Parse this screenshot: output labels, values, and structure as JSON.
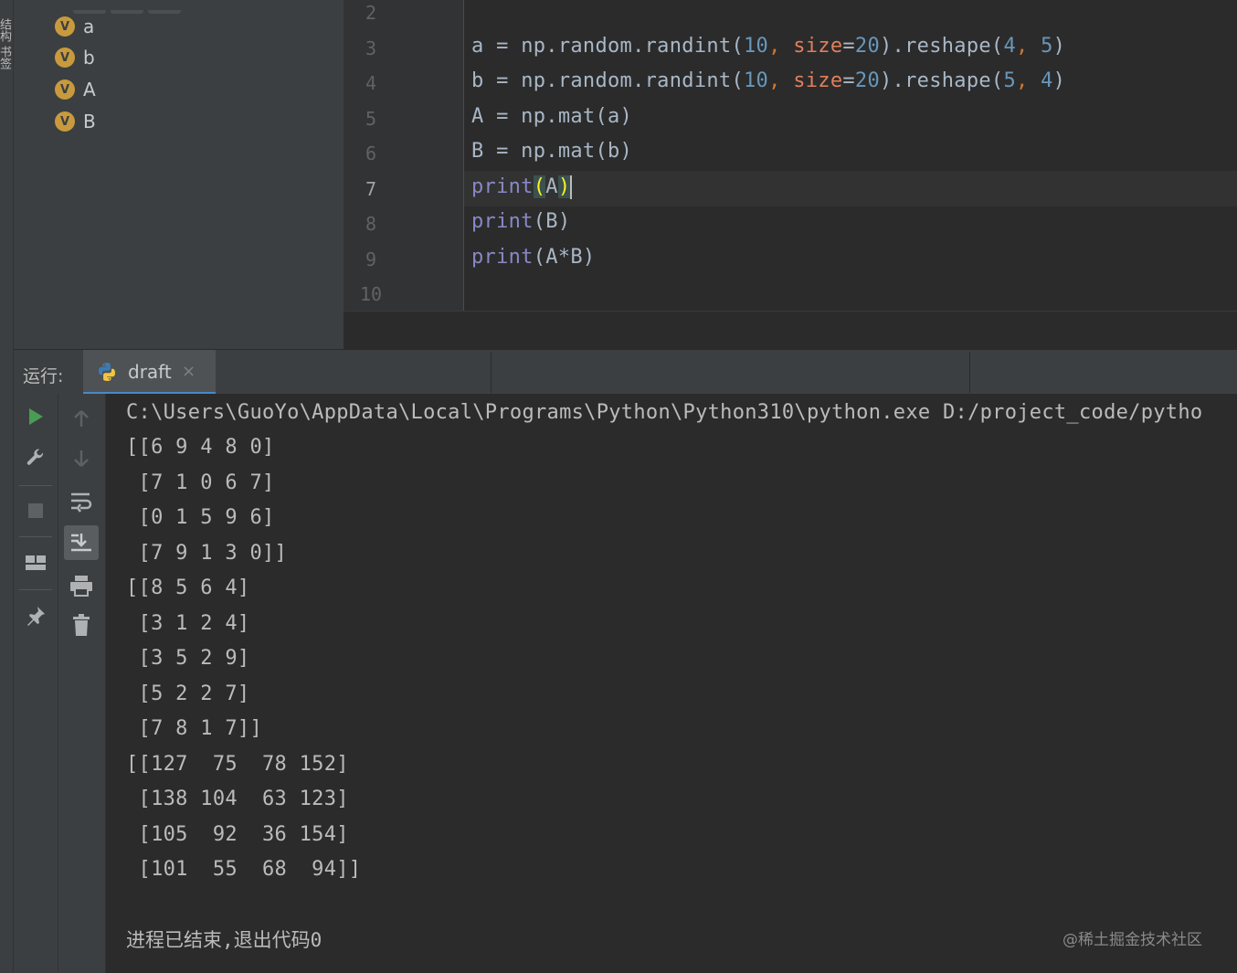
{
  "left_strip": {
    "vertical_label": "结构 书签"
  },
  "variables": [
    {
      "type_badge": "V",
      "name": "a"
    },
    {
      "type_badge": "V",
      "name": "b"
    },
    {
      "type_badge": "V",
      "name": "A"
    },
    {
      "type_badge": "V",
      "name": "B"
    }
  ],
  "editor": {
    "line_numbers": [
      "2",
      "3",
      "4",
      "5",
      "6",
      "7",
      "8",
      "9",
      "10"
    ],
    "current_line": "7",
    "lines": {
      "l3": {
        "var": "a",
        "eq": " = ",
        "call": "np.random.randint(",
        "n1": "10",
        "c1": ", ",
        "kwname": "size",
        "eq2": "=",
        "n2": "20",
        "mid": ").reshape(",
        "n3": "4",
        "c2": ", ",
        "n4": "5",
        "end": ")"
      },
      "l4": {
        "var": "b",
        "eq": " = ",
        "call": "np.random.randint(",
        "n1": "10",
        "c1": ", ",
        "kwname": "size",
        "eq2": "=",
        "n2": "20",
        "mid": ").reshape(",
        "n3": "5",
        "c2": ", ",
        "n4": "4",
        "end": ")"
      },
      "l5": "A = np.mat(a)",
      "l6": "B = np.mat(b)",
      "l7": {
        "fn": "print",
        "open": "(",
        "arg": "A",
        "close": ")"
      },
      "l8": {
        "fn": "print",
        "rest": "(B)"
      },
      "l9": {
        "fn": "print",
        "rest": "(A*B)"
      }
    }
  },
  "run_window": {
    "label": "运行:",
    "tab_name": "draft",
    "tab_close": "×"
  },
  "toolbar_left": [
    "rerun-icon",
    "wrench-icon",
    "stop-icon",
    "layout-icon",
    "pin-icon"
  ],
  "toolbar_right": [
    "up-arrow-icon",
    "down-arrow-icon",
    "soft-wrap-icon",
    "scroll-to-end-icon",
    "print-icon",
    "trash-icon"
  ],
  "console": {
    "lines": [
      "C:\\Users\\GuoYo\\AppData\\Local\\Programs\\Python\\Python310\\python.exe D:/project_code/pytho",
      "[[6 9 4 8 0]",
      " [7 1 0 6 7]",
      " [0 1 5 9 6]",
      " [7 9 1 3 0]]",
      "[[8 5 6 4]",
      " [3 1 2 4]",
      " [3 5 2 9]",
      " [5 2 2 7]",
      " [7 8 1 7]]",
      "[[127  75  78 152]",
      " [138 104  63 123]",
      " [105  92  36 154]",
      " [101  55  68  94]]"
    ],
    "exit_message": "进程已结束,退出代码0",
    "watermark": "@稀土掘金技术社区"
  },
  "colors": {
    "number": "#6897bb",
    "keyword_arg": "#e07f5c",
    "builtin": "#8888c6",
    "var_badge": "#c89a3e",
    "run_green": "#499c54",
    "tab_underline": "#4a88c7"
  }
}
